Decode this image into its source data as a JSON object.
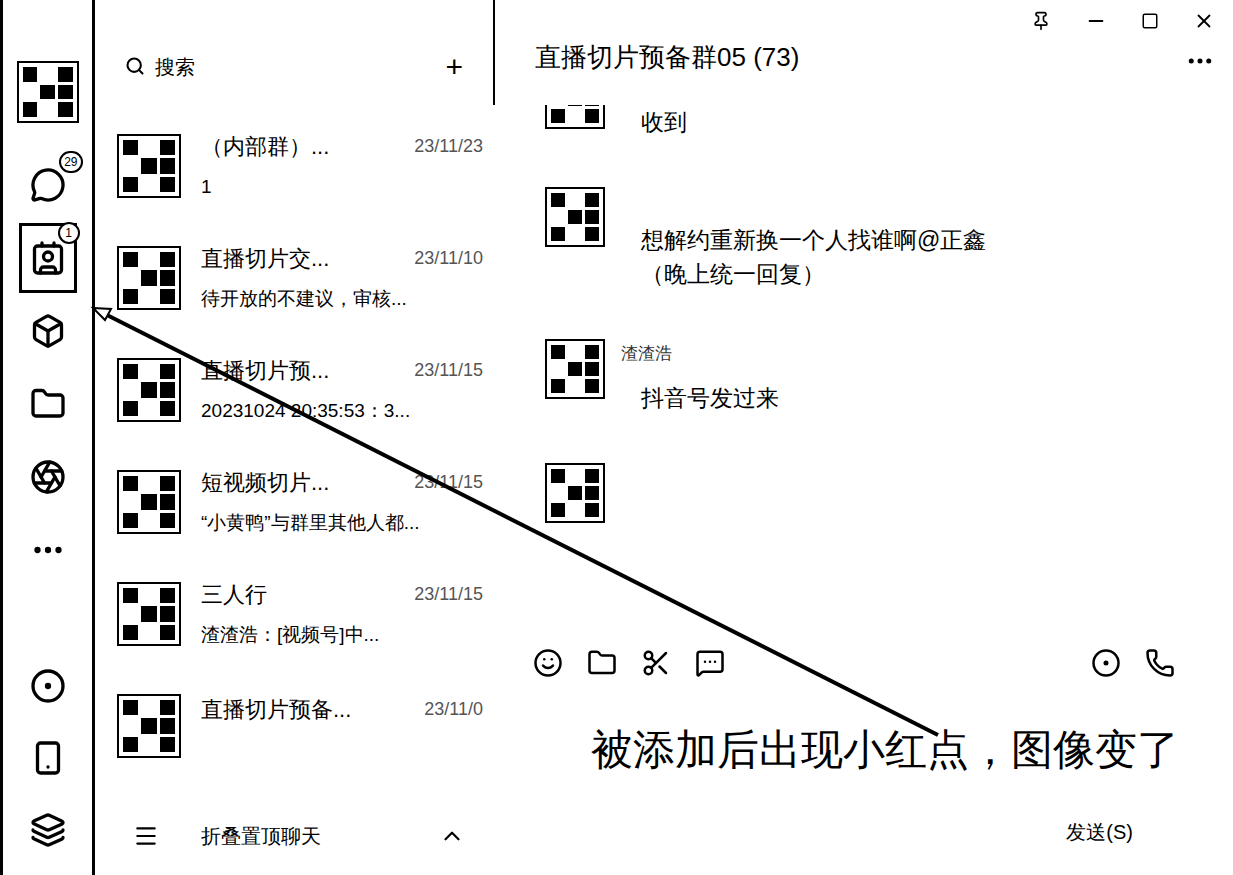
{
  "sidebar": {
    "top_items": [
      {
        "badge": "",
        "selected": false
      },
      {
        "badge": "29",
        "selected": false
      },
      {
        "badge": "1",
        "selected": true
      },
      {
        "badge": "",
        "selected": false
      },
      {
        "badge": "",
        "selected": false
      },
      {
        "badge": "",
        "selected": false
      },
      {
        "badge": "",
        "selected": false
      }
    ],
    "bottom_items": [
      {
        "badge": "",
        "selected": false
      },
      {
        "badge": "",
        "selected": false
      },
      {
        "badge": "",
        "selected": false
      }
    ]
  },
  "search": {
    "placeholder": "搜索",
    "add": "+"
  },
  "chat_list": [
    {
      "title": "（内部群）...",
      "date": "23/11/23",
      "preview": "1"
    },
    {
      "title": "直播切片交...",
      "date": "23/11/10",
      "preview": "待开放的不建议，审核..."
    },
    {
      "title": "直播切片预...",
      "date": "23/11/15",
      "preview": "20231024 20:35:53：3..."
    },
    {
      "title": "短视频切片...",
      "date": "23/11/15",
      "preview": "“小黄鸭”与群里其他人都..."
    },
    {
      "title": "三人行",
      "date": "23/11/15",
      "preview": "渣渣浩：[视频号]中..."
    },
    {
      "title": "直播切片预备...",
      "date": "23/11/0",
      "preview": ""
    }
  ],
  "footer": {
    "label": "折叠置顶聊天"
  },
  "chat": {
    "title": "直播切片预备群05 (73)",
    "messages": [
      {
        "sender": "",
        "text": "收到"
      },
      {
        "sender": "",
        "text": "想解约重新换一个人找谁啊@正鑫（晚上统一回复）"
      },
      {
        "sender": "渣渣浩",
        "text": "抖音号发过来"
      },
      {
        "sender": "",
        "text": ""
      }
    ],
    "send_button": "发送(S)"
  },
  "annotation": {
    "text": "被添加后出现小红点，图像变了"
  }
}
